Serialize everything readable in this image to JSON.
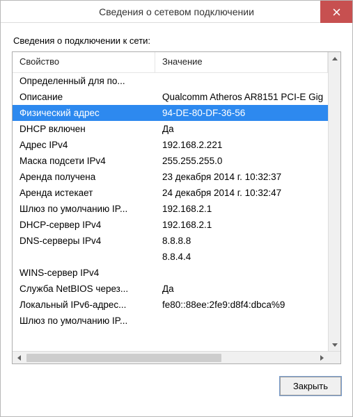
{
  "window": {
    "title": "Сведения о сетевом подключении"
  },
  "section_label": "Сведения о подключении к сети:",
  "columns": {
    "property": "Свойство",
    "value": "Значение"
  },
  "rows": [
    {
      "prop": "Определенный для по...",
      "val": ""
    },
    {
      "prop": "Описание",
      "val": "Qualcomm Atheros AR8151 PCI-E Gig"
    },
    {
      "prop": "Физический адрес",
      "val": "94-DE-80-DF-36-56",
      "selected": true
    },
    {
      "prop": "DHCP включен",
      "val": "Да"
    },
    {
      "prop": "Адрес IPv4",
      "val": "192.168.2.221"
    },
    {
      "prop": "Маска подсети IPv4",
      "val": "255.255.255.0"
    },
    {
      "prop": "Аренда получена",
      "val": "23 декабря 2014 г. 10:32:37"
    },
    {
      "prop": "Аренда истекает",
      "val": "24 декабря 2014 г. 10:32:47"
    },
    {
      "prop": "Шлюз по умолчанию IP...",
      "val": "192.168.2.1"
    },
    {
      "prop": "DHCP-сервер IPv4",
      "val": "192.168.2.1"
    },
    {
      "prop": "DNS-серверы IPv4",
      "val": "8.8.8.8"
    },
    {
      "prop": "",
      "val": "8.8.4.4"
    },
    {
      "prop": "WINS-сервер IPv4",
      "val": ""
    },
    {
      "prop": "Служба NetBIOS через...",
      "val": "Да"
    },
    {
      "prop": "Локальный IPv6-адрес...",
      "val": "fe80::88ee:2fe9:d8f4:dbca%9"
    },
    {
      "prop": "Шлюз по умолчанию IP...",
      "val": ""
    }
  ],
  "buttons": {
    "close": "Закрыть"
  }
}
